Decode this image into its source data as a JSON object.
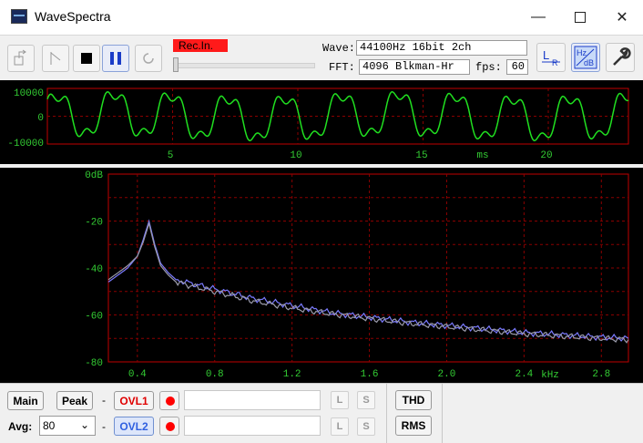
{
  "window": {
    "title": "WaveSpectra"
  },
  "toolbar": {
    "rec_label": "Rec.In.",
    "wave_label": "Wave:",
    "wave_value": "44100Hz 16bit 2ch",
    "fft_label": "FFT:",
    "fft_value": "4096 Blkman-Hr",
    "fps_label": "fps:",
    "fps_value": "60",
    "buttons": [
      "export-icon",
      "marker-icon",
      "stop-icon",
      "pause-icon",
      "refresh-icon",
      "channel-lr-icon",
      "hz-db-icon",
      "settings-wrench-icon"
    ]
  },
  "waveform": {
    "y_ticks": [
      "10000",
      "0",
      "-10000"
    ],
    "x_ticks": [
      "5",
      "10",
      "15",
      "20"
    ],
    "x_unit": "ms",
    "xlim": [
      0,
      23.2
    ],
    "ylim": [
      -10000,
      10000
    ]
  },
  "chart_data": {
    "type": "line",
    "xlabel": "kHz",
    "x_ticks": [
      "0.4",
      "0.8",
      "1.2",
      "1.6",
      "2.0",
      "2.4",
      "2.8"
    ],
    "y_ticks": [
      "0dB",
      "-20",
      "-40",
      "-60",
      "-80"
    ],
    "xlim": [
      0.25,
      2.94
    ],
    "ylim": [
      -80,
      0
    ],
    "series": [
      {
        "x": [
          0.25,
          0.3,
          0.35,
          0.4,
          0.43,
          0.46,
          0.49,
          0.52,
          0.56,
          0.6,
          0.7,
          0.8,
          0.9,
          1.0,
          1.2,
          1.4,
          1.6,
          1.8,
          2.0,
          2.2,
          2.4,
          2.6,
          2.8,
          2.94
        ],
        "values": [
          -46,
          -43,
          -40,
          -35,
          -28,
          -20,
          -30,
          -38,
          -42,
          -45,
          -47,
          -49,
          -51,
          -53,
          -56,
          -59,
          -61,
          -63,
          -64.5,
          -66,
          -67.5,
          -68.5,
          -69.5,
          -70
        ]
      },
      {
        "x": [
          0.25,
          0.3,
          0.35,
          0.4,
          0.43,
          0.46,
          0.49,
          0.52,
          0.56,
          0.6,
          0.7,
          0.8,
          0.9,
          1.0,
          1.2,
          1.4,
          1.6,
          1.8,
          2.0,
          2.2,
          2.4,
          2.6,
          2.8,
          2.94
        ],
        "values": [
          -45,
          -42,
          -39,
          -35,
          -29,
          -21,
          -31,
          -39,
          -43,
          -46,
          -48,
          -50,
          -52,
          -54,
          -57,
          -59.5,
          -61.5,
          -63.5,
          -65,
          -66.5,
          -68,
          -69,
          -70,
          -70.5
        ]
      }
    ]
  },
  "bottom": {
    "main_label": "Main",
    "peak_label": "Peak",
    "dash1": "-",
    "ovl1_label": "OVL1",
    "ovl1_text": "",
    "l1": "L",
    "s1": "S",
    "thd_label": "THD",
    "avg_label": "Avg:",
    "avg_value": "80",
    "dash2": "-",
    "ovl2_label": "OVL2",
    "ovl2_text": "",
    "l2": "L",
    "s2": "S",
    "rms_label": "RMS"
  }
}
